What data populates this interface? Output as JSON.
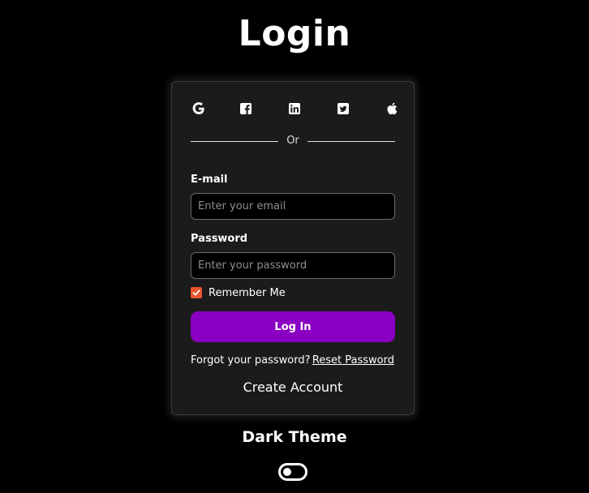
{
  "page": {
    "title": "Login"
  },
  "social": {
    "buttons": [
      {
        "icon": "google-icon"
      },
      {
        "icon": "facebook-icon"
      },
      {
        "icon": "linkedin-icon"
      },
      {
        "icon": "twitter-icon"
      },
      {
        "icon": "apple-icon"
      }
    ]
  },
  "divider": {
    "text": "Or"
  },
  "form": {
    "email_label": "E-mail",
    "email_placeholder": "Enter your email",
    "email_value": "",
    "password_label": "Password",
    "password_placeholder": "Enter your password",
    "password_value": "",
    "remember_label": "Remember Me",
    "remember_checked": true,
    "login_label": "Log In",
    "forgot_text": "Forgot your password?",
    "reset_link": "Reset Password",
    "create_account": "Create Account"
  },
  "theme": {
    "label": "Dark Theme",
    "toggle_on": false
  },
  "colors": {
    "background": "#000000",
    "card": "#1b1b1c",
    "accent": "#8a00c2",
    "checkbox": "#e8532f"
  }
}
